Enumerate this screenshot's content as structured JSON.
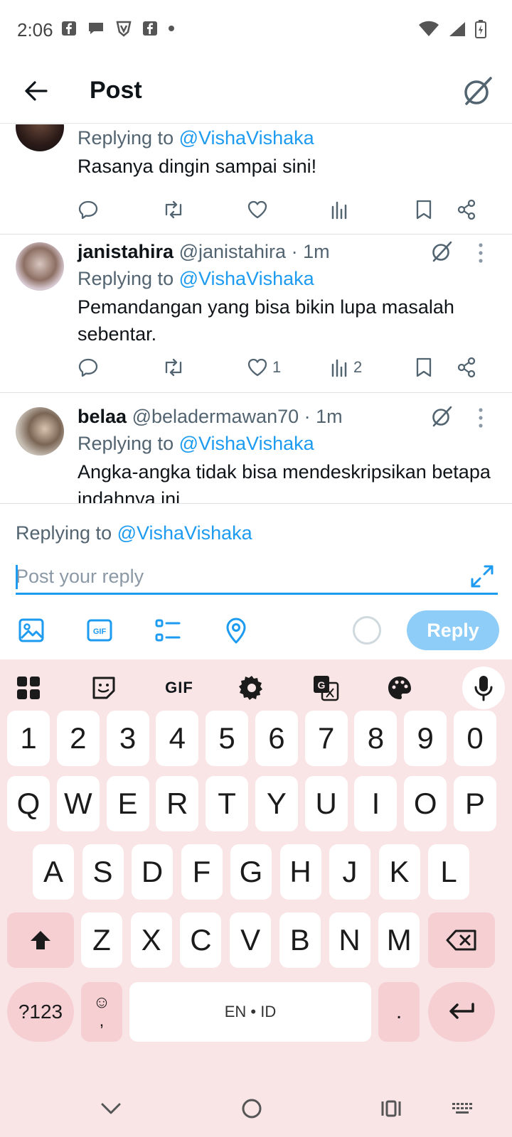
{
  "status_bar": {
    "time": "2:06"
  },
  "header": {
    "title": "Post"
  },
  "posts": [
    {
      "reply_prefix": "Replying to ",
      "mention": "@VishaVishaka",
      "text": "Rasanya dingin sampai sini!",
      "likes": "",
      "views": ""
    },
    {
      "username": "janistahira",
      "handle": "@janistahira",
      "time": "· 1m",
      "reply_prefix": "Replying to ",
      "mention": "@VishaVishaka",
      "text": "Pemandangan yang bisa bikin lupa masalah sebentar.",
      "likes": "1",
      "views": "2"
    },
    {
      "username": "belaa",
      "handle": "@beladermawan70",
      "time": "· 1m",
      "reply_prefix": "Replying to ",
      "mention": "@VishaVishaka",
      "text": "Angka-angka tidak bisa mendeskripsikan betapa indahnya ini"
    }
  ],
  "composer": {
    "reply_prefix": "Replying to ",
    "mention": "@VishaVishaka",
    "placeholder": "Post your reply",
    "reply_button": "Reply"
  },
  "keyboard": {
    "toolbar_gif": "GIF",
    "number_row": [
      "1",
      "2",
      "3",
      "4",
      "5",
      "6",
      "7",
      "8",
      "9",
      "0"
    ],
    "row1": [
      "Q",
      "W",
      "E",
      "R",
      "T",
      "Y",
      "U",
      "I",
      "O",
      "P"
    ],
    "row2": [
      "A",
      "S",
      "D",
      "F",
      "G",
      "H",
      "J",
      "K",
      "L"
    ],
    "row3": [
      "Z",
      "X",
      "C",
      "V",
      "B",
      "N",
      "M"
    ],
    "symbols_key": "?123",
    "emoji_key": "☺",
    "comma_key": ",",
    "space_label": "EN • ID",
    "period_key": "."
  },
  "colors": {
    "accent": "#1d9bf0",
    "reply_button": "#8ecdf8",
    "keyboard_bg": "#f9e4e6",
    "keyboard_special": "#f6cfd3"
  }
}
